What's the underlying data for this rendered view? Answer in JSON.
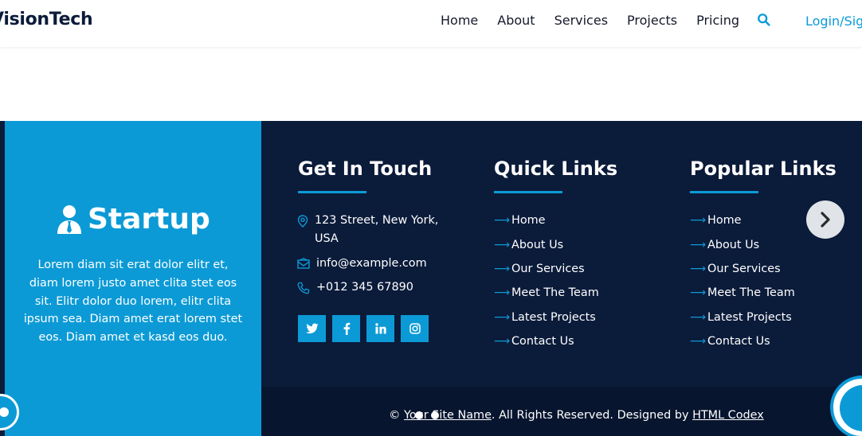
{
  "navbar": {
    "brand": "VisionTech",
    "links": [
      "Home",
      "About",
      "Services",
      "Projects",
      "Pricing"
    ],
    "search_icon": "search-icon",
    "login": "Login/Sign Up"
  },
  "colors": {
    "accent": "#0c9ad6",
    "footer_bg": "#0b1b3a",
    "bottom_bar": "#08152f"
  },
  "brand_panel": {
    "title": "Startup",
    "icon": "user-tie-icon",
    "description": "Lorem diam sit erat dolor elitr et, diam lorem justo amet clita stet eos sit. Elitr dolor duo lorem, elitr clita ipsum sea. Diam amet erat lorem stet eos. Diam amet et kasd eos duo."
  },
  "get_in_touch": {
    "title": "Get In Touch",
    "address": "123 Street, New York, USA",
    "email": "info@example.com",
    "phone": "+012 345 67890",
    "social": [
      "twitter-icon",
      "facebook-icon",
      "linkedin-icon",
      "instagram-icon"
    ]
  },
  "quick_links": {
    "title": "Quick Links",
    "items": [
      "Home",
      "About Us",
      "Our Services",
      "Meet The Team",
      "Latest Projects",
      "Contact Us"
    ]
  },
  "popular_links": {
    "title": "Popular Links",
    "items": [
      "Home",
      "About Us",
      "Our Services",
      "Meet The Team",
      "Latest Projects",
      "Contact Us"
    ]
  },
  "copyright": {
    "prefix": "©",
    "site_name": "Your Site Name",
    "middle": ". All Rights Reserved. Designed by",
    "designer": "HTML Codex"
  }
}
